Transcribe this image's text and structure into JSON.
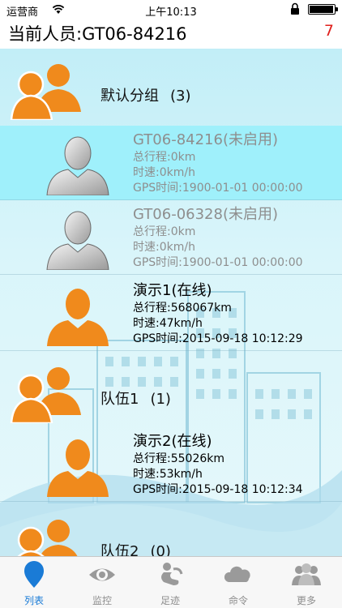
{
  "status_bar": {
    "carrier": "运营商",
    "time": "上午10:13"
  },
  "header": {
    "title": "当前人员:GT06-84216",
    "count": "7"
  },
  "groups": [
    {
      "name": "默认分组",
      "count": "(3)"
    },
    {
      "name": "队伍1",
      "count": "(1)"
    },
    {
      "name": "队伍2",
      "count": "(0)"
    }
  ],
  "persons": [
    {
      "name": "GT06-84216(未启用)",
      "mileage": "总行程:0km",
      "speed": "时速:0km/h",
      "gps_time": "GPS时间:1900-01-01 00:00:00",
      "status": "offline",
      "selected": true
    },
    {
      "name": "GT06-06328(未启用)",
      "mileage": "总行程:0km",
      "speed": "时速:0km/h",
      "gps_time": "GPS时间:1900-01-01 00:00:00",
      "status": "offline",
      "selected": false
    },
    {
      "name": "演示1(在线)",
      "mileage": "总行程:568067km",
      "speed": "时速:47km/h",
      "gps_time": "GPS时间:2015-09-18 10:12:29",
      "status": "online",
      "selected": false
    },
    {
      "name": "演示2(在线)",
      "mileage": "总行程:55026km",
      "speed": "时速:53km/h",
      "gps_time": "GPS时间:2015-09-18 10:12:34",
      "status": "online",
      "selected": false
    }
  ],
  "tabs": [
    {
      "label": "列表",
      "icon": "location-pin-icon",
      "active": true
    },
    {
      "label": "监控",
      "icon": "eye-icon",
      "active": false
    },
    {
      "label": "足迹",
      "icon": "footprint-icon",
      "active": false
    },
    {
      "label": "命令",
      "icon": "cloud-icon",
      "active": false
    },
    {
      "label": "更多",
      "icon": "people-icon",
      "active": false
    }
  ],
  "colors": {
    "accent": "#1a7bd6",
    "alert": "#e0201c",
    "selected_row": "#9ff0fb",
    "group_orange": "#f08a1c",
    "list_background": "#c2eef7"
  }
}
